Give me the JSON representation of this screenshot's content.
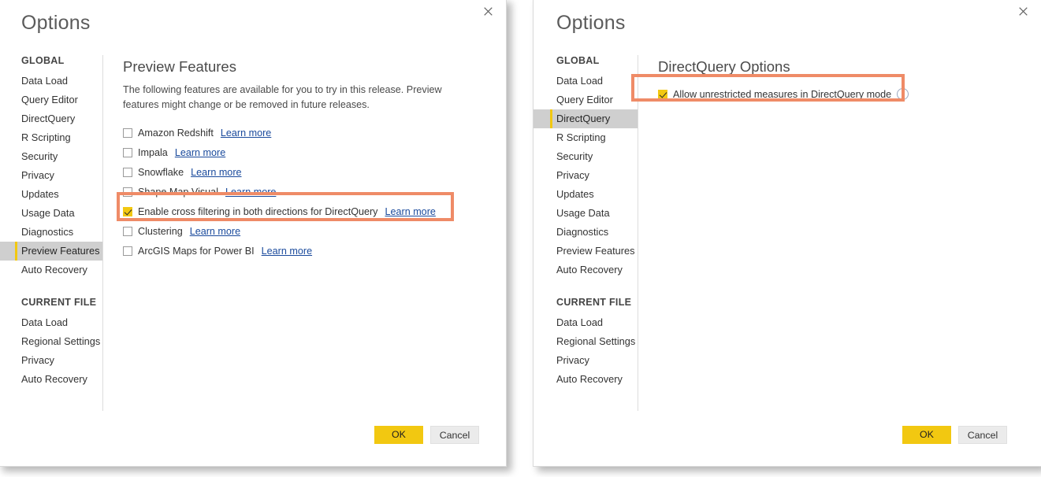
{
  "accent": {
    "yellow": "#f2c811",
    "highlight_orange": "#ef8b67",
    "selected_gray": "#cfcfcf",
    "link_blue": "#1a4a9c"
  },
  "left_dialog": {
    "title": "Options",
    "close_label": "close-icon",
    "sidebar": {
      "groups": [
        {
          "title": "GLOBAL",
          "items": [
            {
              "label": "Data Load",
              "selected": false
            },
            {
              "label": "Query Editor",
              "selected": false
            },
            {
              "label": "DirectQuery",
              "selected": false
            },
            {
              "label": "R Scripting",
              "selected": false
            },
            {
              "label": "Security",
              "selected": false
            },
            {
              "label": "Privacy",
              "selected": false
            },
            {
              "label": "Updates",
              "selected": false
            },
            {
              "label": "Usage Data",
              "selected": false
            },
            {
              "label": "Diagnostics",
              "selected": false
            },
            {
              "label": "Preview Features",
              "selected": true
            },
            {
              "label": "Auto Recovery",
              "selected": false
            }
          ]
        },
        {
          "title": "CURRENT FILE",
          "items": [
            {
              "label": "Data Load",
              "selected": false
            },
            {
              "label": "Regional Settings",
              "selected": false
            },
            {
              "label": "Privacy",
              "selected": false
            },
            {
              "label": "Auto Recovery",
              "selected": false
            }
          ]
        }
      ]
    },
    "content": {
      "heading": "Preview Features",
      "description": "The following features are available for you to try in this release. Preview features might change or be removed in future releases.",
      "features": [
        {
          "label": "Amazon Redshift",
          "checked": false,
          "link": "Learn more"
        },
        {
          "label": "Impala",
          "checked": false,
          "link": "Learn more"
        },
        {
          "label": "Snowflake",
          "checked": false,
          "link": "Learn more"
        },
        {
          "label": "Shape Map Visual",
          "checked": false,
          "link": "Learn more"
        },
        {
          "label": "Enable cross filtering in both directions for DirectQuery",
          "checked": true,
          "link": "Learn more"
        },
        {
          "label": "Clustering",
          "checked": false,
          "link": "Learn more"
        },
        {
          "label": "ArcGIS Maps for Power BI",
          "checked": false,
          "link": "Learn more"
        }
      ]
    },
    "footer": {
      "ok_label": "OK",
      "cancel_label": "Cancel"
    }
  },
  "right_dialog": {
    "title": "Options",
    "close_label": "close-icon",
    "sidebar": {
      "groups": [
        {
          "title": "GLOBAL",
          "items": [
            {
              "label": "Data Load",
              "selected": false
            },
            {
              "label": "Query Editor",
              "selected": false
            },
            {
              "label": "DirectQuery",
              "selected": true
            },
            {
              "label": "R Scripting",
              "selected": false
            },
            {
              "label": "Security",
              "selected": false
            },
            {
              "label": "Privacy",
              "selected": false
            },
            {
              "label": "Updates",
              "selected": false
            },
            {
              "label": "Usage Data",
              "selected": false
            },
            {
              "label": "Diagnostics",
              "selected": false
            },
            {
              "label": "Preview Features",
              "selected": false
            },
            {
              "label": "Auto Recovery",
              "selected": false
            }
          ]
        },
        {
          "title": "CURRENT FILE",
          "items": [
            {
              "label": "Data Load",
              "selected": false
            },
            {
              "label": "Regional Settings",
              "selected": false
            },
            {
              "label": "Privacy",
              "selected": false
            },
            {
              "label": "Auto Recovery",
              "selected": false
            }
          ]
        }
      ]
    },
    "content": {
      "heading": "DirectQuery Options",
      "features": [
        {
          "label": "Allow unrestricted measures in DirectQuery mode",
          "checked": true,
          "info": "i"
        }
      ]
    },
    "footer": {
      "ok_label": "OK",
      "cancel_label": "Cancel"
    }
  }
}
